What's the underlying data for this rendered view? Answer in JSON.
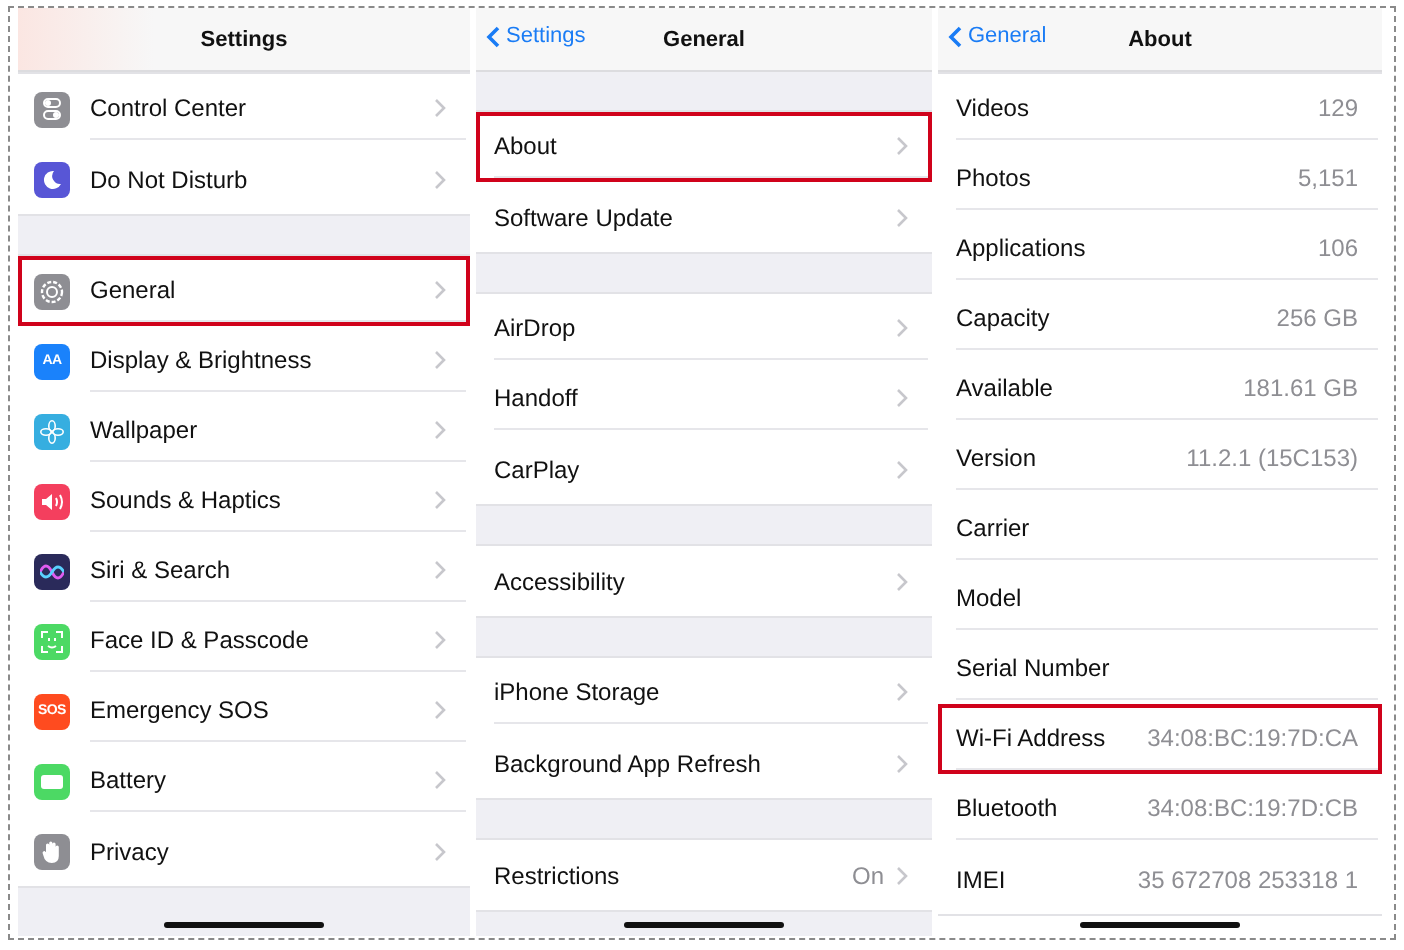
{
  "panels": [
    {
      "title": "Settings",
      "chevrons": true,
      "groups": [
        {
          "rows": [
            {
              "label": "Control Center",
              "kind": "switches",
              "highlighted": false
            },
            {
              "label": "Do Not Disturb",
              "kind": "moon",
              "highlighted": false
            }
          ]
        },
        {
          "rows": [
            {
              "label": "General",
              "kind": "gear",
              "highlighted": true
            },
            {
              "label": "Display & Brightness",
              "kind": "letters",
              "icon_text": "AA",
              "highlighted": false
            },
            {
              "label": "Wallpaper",
              "kind": "flower",
              "highlighted": false
            },
            {
              "label": "Sounds & Haptics",
              "kind": "speaker",
              "highlighted": false
            },
            {
              "label": "Siri & Search",
              "kind": "siri",
              "highlighted": false
            },
            {
              "label": "Face ID & Passcode",
              "kind": "face",
              "highlighted": false
            },
            {
              "label": "Emergency SOS",
              "kind": "sos",
              "icon_text": "SOS",
              "highlighted": false
            },
            {
              "label": "Battery",
              "kind": "battery",
              "highlighted": false
            },
            {
              "label": "Privacy",
              "kind": "hand",
              "highlighted": false
            }
          ]
        }
      ]
    },
    {
      "title": "General",
      "back": "Settings",
      "chevrons": true,
      "groups": [
        {
          "rows": [
            {
              "label": "About",
              "highlighted": true
            },
            {
              "label": "Software Update",
              "highlighted": false
            }
          ]
        },
        {
          "rows": [
            {
              "label": "AirDrop",
              "highlighted": false
            },
            {
              "label": "Handoff",
              "highlighted": false
            },
            {
              "label": "CarPlay",
              "highlighted": false
            }
          ]
        },
        {
          "rows": [
            {
              "label": "Accessibility",
              "highlighted": false
            }
          ]
        },
        {
          "rows": [
            {
              "label": "iPhone Storage",
              "highlighted": false
            },
            {
              "label": "Background App Refresh",
              "highlighted": false
            }
          ]
        },
        {
          "rows": [
            {
              "label": "Restrictions",
              "value": "On",
              "highlighted": false
            }
          ]
        }
      ]
    },
    {
      "title": "About",
      "back": "General",
      "chevrons": false,
      "groups": [
        {
          "rows": [
            {
              "label": "Videos",
              "value": "129",
              "highlighted": false
            },
            {
              "label": "Photos",
              "value": "5,151",
              "highlighted": false
            },
            {
              "label": "Applications",
              "value": "106",
              "highlighted": false
            },
            {
              "label": "Capacity",
              "value": "256 GB",
              "highlighted": false
            },
            {
              "label": "Available",
              "value": "181.61 GB",
              "highlighted": false
            },
            {
              "label": "Version",
              "value": "11.2.1 (15C153)",
              "highlighted": false
            },
            {
              "label": "Carrier",
              "highlighted": false
            },
            {
              "label": "Model",
              "highlighted": false
            },
            {
              "label": "Serial Number",
              "highlighted": false
            },
            {
              "label": "Wi-Fi Address",
              "value": "34:08:BC:19:7D:CA",
              "highlighted": true
            },
            {
              "label": "Bluetooth",
              "value": "34:08:BC:19:7D:CB",
              "highlighted": false
            },
            {
              "label": "IMEI",
              "value": "35 672708 253318 1",
              "highlighted": false
            }
          ]
        }
      ]
    }
  ]
}
